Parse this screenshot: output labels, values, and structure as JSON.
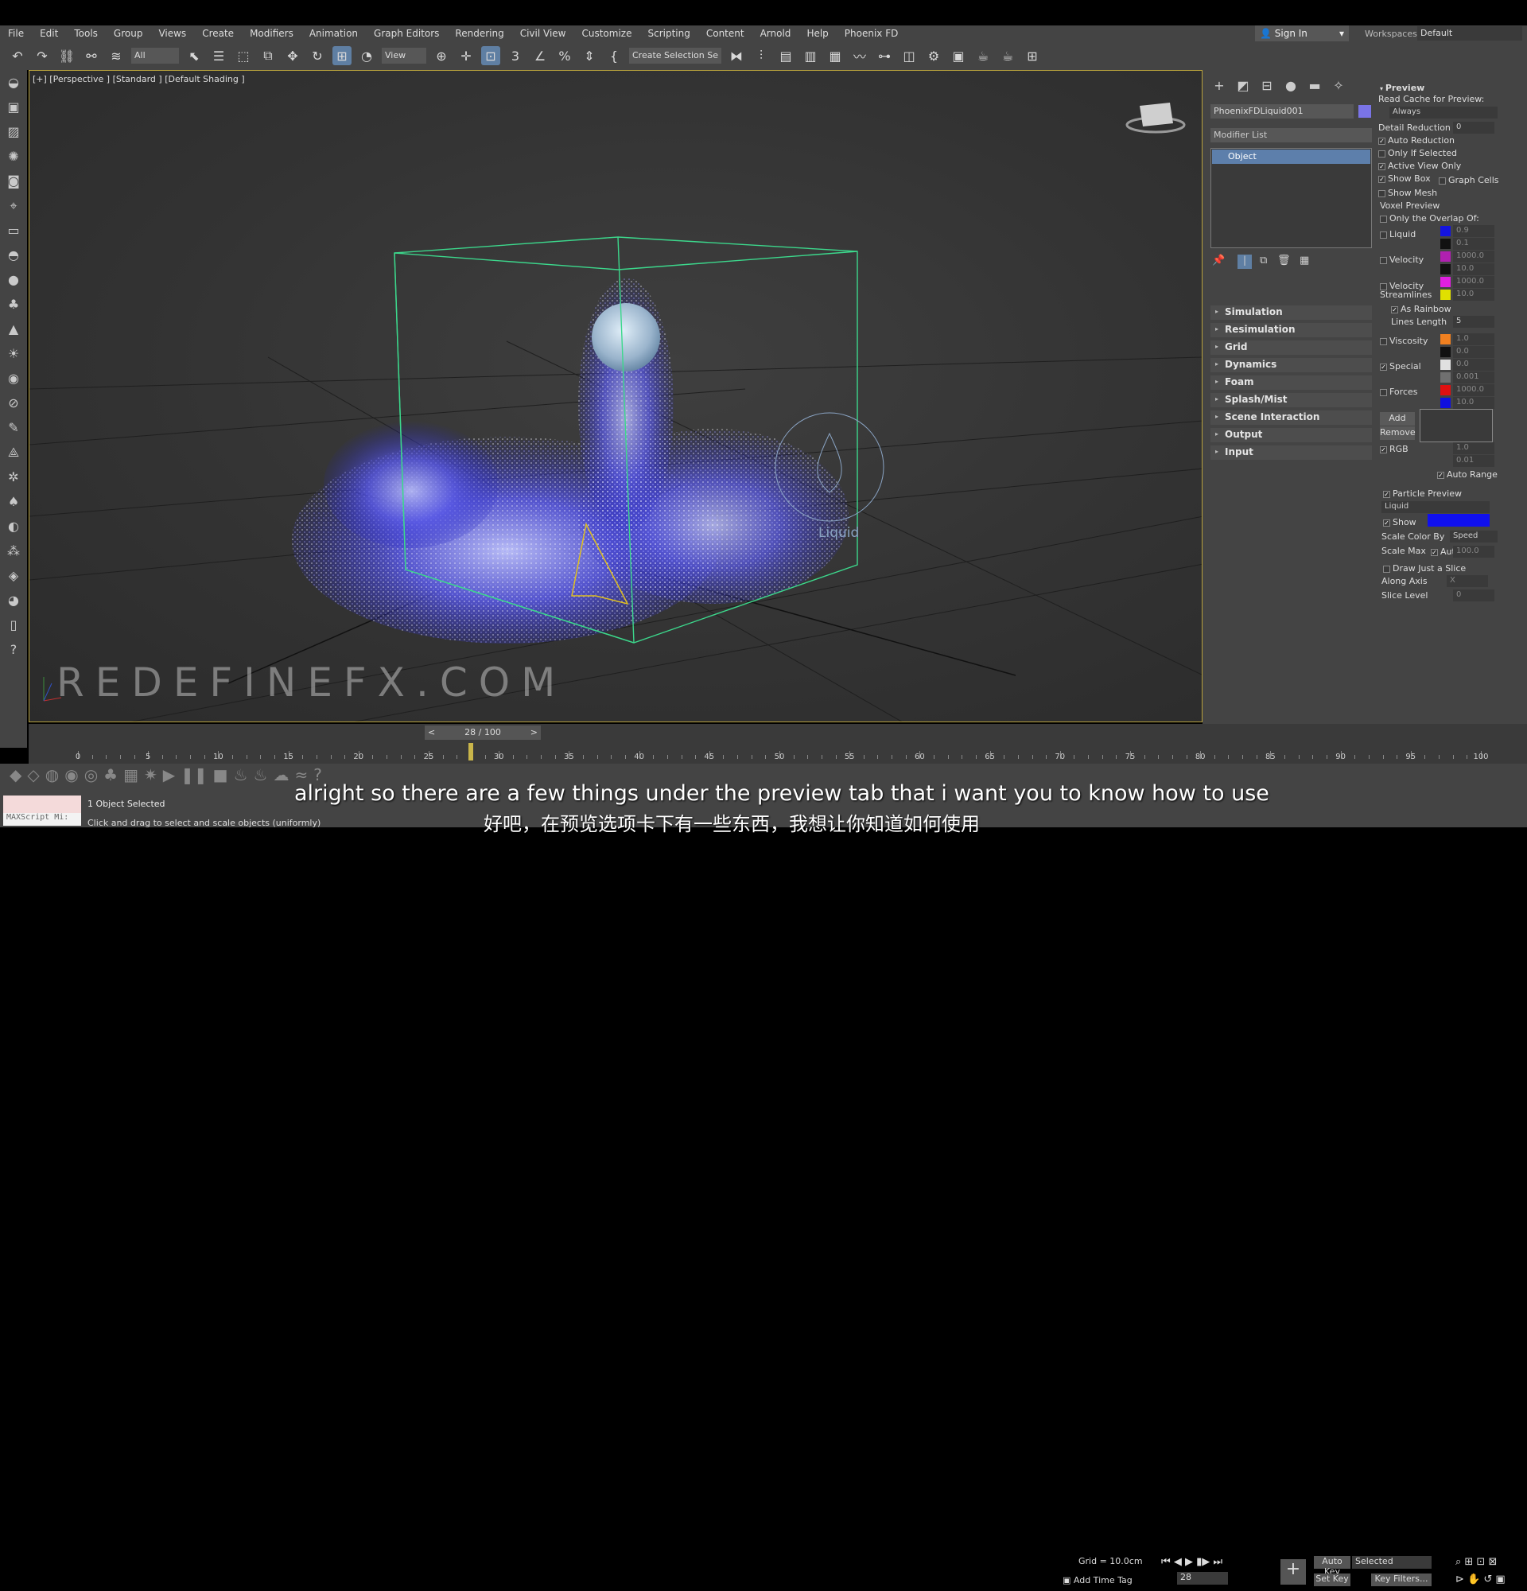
{
  "menu": [
    "File",
    "Edit",
    "Tools",
    "Group",
    "Views",
    "Create",
    "Modifiers",
    "Animation",
    "Graph Editors",
    "Rendering",
    "Civil View",
    "Customize",
    "Scripting",
    "Content",
    "Arnold",
    "Help",
    "Phoenix FD"
  ],
  "signin": "Sign In",
  "workspaces_label": "Workspaces:",
  "workspace_value": "Default",
  "toolbar": {
    "filter": "All",
    "view": "View",
    "selection_set": "Create Selection Se"
  },
  "viewport": {
    "label": "[+] [Perspective ] [Standard ] [Default Shading ]",
    "watermark": "REDEFINEFX.COM",
    "helper_label": "Liquid"
  },
  "cmd": {
    "object_name": "PhoenixFDLiquid001",
    "modifier_list": "Modifier List",
    "stack_item": "Object",
    "rollouts": [
      "Simulation",
      "Resimulation",
      "Grid",
      "Dynamics",
      "Foam",
      "Splash/Mist",
      "Scene Interaction",
      "Output",
      "Input"
    ]
  },
  "preview": {
    "title": "Preview",
    "read_cache": "Read Cache for Preview:",
    "always": "Always",
    "detail_reduction": "Detail Reduction",
    "detail_val": "0",
    "auto_reduction": "Auto Reduction",
    "only_if_selected": "Only If Selected",
    "active_view_only": "Active View Only",
    "show_box": "Show Box",
    "graph_cells": "Graph Cells",
    "show_mesh": "Show Mesh",
    "voxel_preview": "Voxel Preview",
    "only_overlap": "Only the Overlap Of:",
    "liquid": "Liquid",
    "liquid_v1": "0.9",
    "liquid_v2": "0.1",
    "velocity": "Velocity",
    "vel_v1": "1000.0",
    "vel_v2": "10.0",
    "vel_stream": "Velocity Streamlines",
    "vs_v1": "1000.0",
    "vs_v2": "10.0",
    "as_rainbow": "As Rainbow",
    "lines_length": "Lines Length",
    "ll_val": "5",
    "viscosity": "Viscosity",
    "visc_v1": "1.0",
    "visc_v2": "0.0",
    "special": "Special",
    "spec_v1": "0.0",
    "spec_v2": "0.001",
    "forces": "Forces",
    "f_v1": "1000.0",
    "f_v2": "10.0",
    "add": "Add",
    "remove": "Remove",
    "rgb": "RGB",
    "rgb_v1": "1.0",
    "rgb_v2": "0.01",
    "auto_range": "Auto Range",
    "particle_preview": "Particle Preview",
    "pp_select": "Liquid",
    "show": "Show",
    "scale_color_by": "Scale Color By",
    "speed": "Speed",
    "scale_max": "Scale Max",
    "auto": "Auto",
    "scale_max_val": "100.0",
    "draw_slice": "Draw Just a Slice",
    "along_axis": "Along Axis",
    "axis_val": "X",
    "slice_level": "Slice Level",
    "slice_val": "0",
    "colors": {
      "liquid": "#1414e0",
      "velocity": "#b020b0",
      "vel_stream": "#e020e0",
      "vs_low": "#e0e000",
      "viscosity": "#f08020",
      "special": "#e0e0e0",
      "special_low": "#707070",
      "forces": "#e01010",
      "forces_low": "#1010e0",
      "show": "#1010ee"
    }
  },
  "timeline": {
    "frame": "28 / 100",
    "labels": [
      "0",
      "5",
      "10",
      "15",
      "20",
      "25",
      "30",
      "35",
      "40",
      "45",
      "50",
      "55",
      "60",
      "65",
      "70",
      "75",
      "80",
      "85",
      "90",
      "95",
      "100"
    ],
    "current": 28
  },
  "status": {
    "selected": "1 Object Selected",
    "hint": "Click and drag to select and scale objects (uniformly)",
    "maxscript": "MAXScript Mi:"
  },
  "subtitles": {
    "en": "alright so there are a few things under the preview tab that i want you to know how to use",
    "zh": "好吧，在预览选项卡下有一些东西，我想让你知道如何使用"
  },
  "bottom_right": {
    "grid": "Grid = 10.0cm",
    "add_time_tag": "Add Time Tag",
    "auto_key": "Auto Key",
    "selected": "Selected",
    "set_key": "Set Key",
    "key_filters": "Key Filters...",
    "frame": "28"
  }
}
